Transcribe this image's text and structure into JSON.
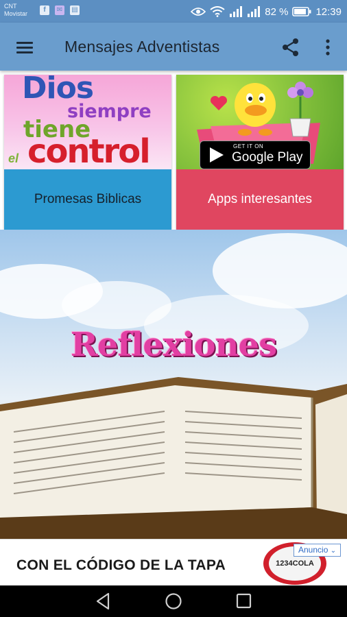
{
  "status_bar": {
    "carrier_line1": "CNT",
    "carrier_line2": "Movistar",
    "battery_percent": "82 %",
    "time": "12:39",
    "icons": [
      "facebook-icon",
      "messenger-icon",
      "clipboard-icon",
      "eye-icon",
      "wifi-icon",
      "signal-icon",
      "signal-icon",
      "battery-icon"
    ]
  },
  "app_bar": {
    "title": "Mensajes Adventistas",
    "menu_icon": "hamburger-icon",
    "share_icon": "share-icon",
    "more_icon": "more-vert-icon",
    "color": "#6a9dcd"
  },
  "cards": [
    {
      "label": "Promesas Biblicas",
      "image_text": [
        "Dios",
        "siempre",
        "tiene",
        "el",
        "control"
      ],
      "color": "#2c9ad1"
    },
    {
      "label": "Apps interesantes",
      "badge_small": "GET IT ON",
      "badge_large": "Google Play",
      "color": "#e04660"
    }
  ],
  "banner": {
    "title": "Reflexiones"
  },
  "ad": {
    "text": "CON EL CÓDIGO DE LA TAPA",
    "cap_text": "1234COLA",
    "label": "Anuncio",
    "accent": "#d1202c"
  },
  "nav_bar": {
    "icons": [
      "back-icon",
      "home-icon",
      "recents-icon"
    ]
  }
}
